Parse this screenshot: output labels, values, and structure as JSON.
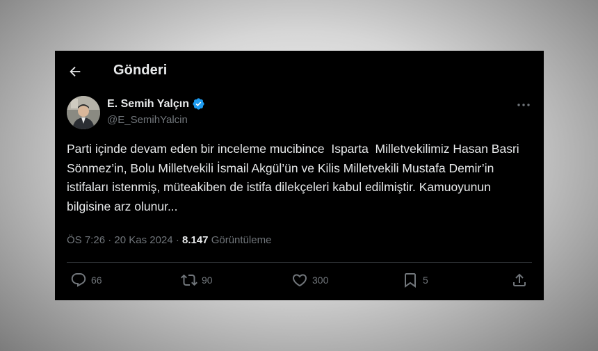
{
  "header": {
    "title": "Gönderi",
    "back_icon": "arrow-left-icon"
  },
  "author": {
    "name": "E. Semih Yalçın",
    "handle": "@E_SemihYalcin",
    "verified": true,
    "verified_color": "#1d9bf0"
  },
  "tweet": {
    "text": "Parti içinde devam eden bir inceleme mucibince  Isparta  Milletvekilimiz Hasan Basri Sönmez’in, Bolu Milletvekili İsmail Akgül’ün ve Kilis Milletvekili Mustafa Demir’in istifaları istenmiş, müteakiben de istifa dilekçeleri kabul edilmiştir. Kamuoyunun bilgisine arz olunur...",
    "time": "ÖS 7:26",
    "separator": "·",
    "date": "20 Kas 2024",
    "views": "8.147",
    "views_label": "Görüntüleme"
  },
  "actions": {
    "replies": "66",
    "reposts": "90",
    "likes": "300",
    "bookmarks": "5"
  },
  "colors": {
    "background": "#000000",
    "text": "#e7e9ea",
    "muted": "#71767b",
    "border": "#2f3336"
  }
}
